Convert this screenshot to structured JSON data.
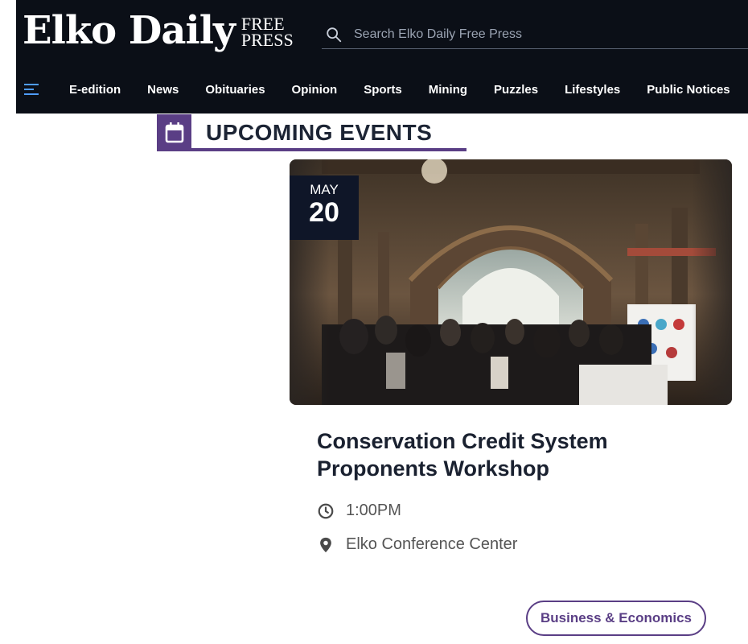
{
  "header": {
    "logo_main": "Elko Daily",
    "logo_free": "FREE",
    "logo_press": "PRESS",
    "search_placeholder": "Search Elko Daily Free Press",
    "menu_icon": "hamburger-menu-icon",
    "nav": [
      "E-edition",
      "News",
      "Obituaries",
      "Opinion",
      "Sports",
      "Mining",
      "Puzzles",
      "Lifestyles",
      "Public Notices"
    ]
  },
  "section": {
    "title": "UPCOMING EVENTS",
    "icon": "calendar-icon",
    "accent": "#5a3e85"
  },
  "event": {
    "month": "MAY",
    "day": "20",
    "title": "Conservation Credit System Proponents Workshop",
    "time": "1:00PM",
    "location": "Elko Conference Center",
    "category": "Business & Economics",
    "photo": "exhibition-hall-crowd-photo"
  },
  "colors": {
    "header_bg": "#0b0f17",
    "badge_bg": "#0f1628",
    "text_dark": "#1a2130"
  }
}
